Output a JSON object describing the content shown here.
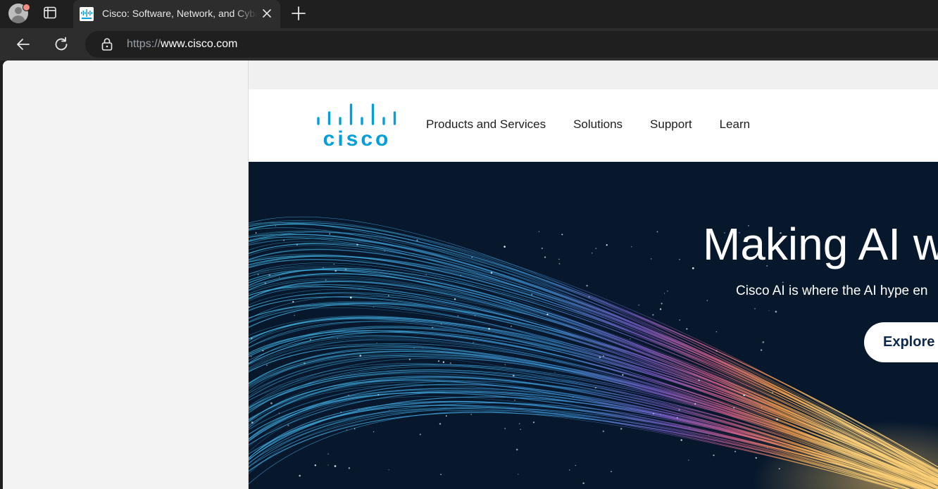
{
  "browser": {
    "tab": {
      "title": "Cisco: Software, Network, and Cybersecurity Solutions"
    },
    "address_bar": {
      "scheme": "https://",
      "host": "www.cisco.com"
    }
  },
  "site": {
    "logo_text": "cisco",
    "nav": [
      "Products and Services",
      "Solutions",
      "Support",
      "Learn"
    ],
    "hero": {
      "title": "Making AI w",
      "subtitle": "Cisco AI is where the AI hype en",
      "button": "Explore C"
    }
  },
  "colors": {
    "brand": "#049fd9",
    "hero_bg": "#07182d",
    "button_text": "#0d274d"
  },
  "icons": [
    "profile-icon",
    "tab-actions-icon",
    "close-icon",
    "plus-icon",
    "back-arrow-icon",
    "reload-icon",
    "lock-icon"
  ]
}
